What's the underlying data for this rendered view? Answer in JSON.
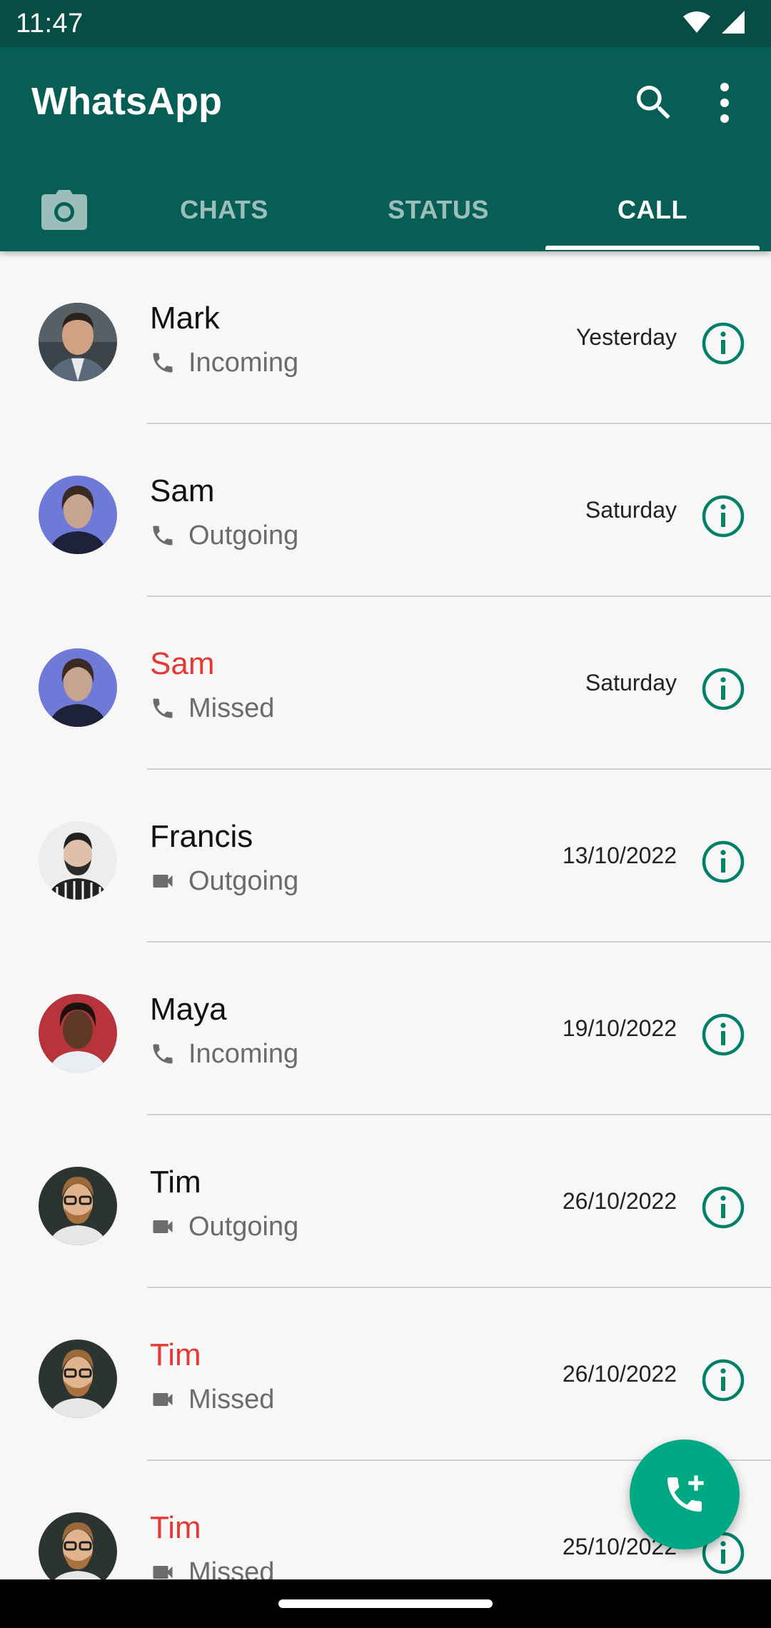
{
  "status_bar": {
    "time": "11:47"
  },
  "app_bar": {
    "title": "WhatsApp"
  },
  "tabs": [
    {
      "label": "CHATS",
      "selected": false
    },
    {
      "label": "STATUS",
      "selected": false
    },
    {
      "label": "CALL",
      "selected": true
    }
  ],
  "calls": [
    {
      "name": "Mark",
      "type": "Incoming",
      "medium": "voice",
      "time": "Yesterday",
      "missed": false
    },
    {
      "name": "Sam",
      "type": "Outgoing",
      "medium": "voice",
      "time": "Saturday",
      "missed": false
    },
    {
      "name": "Sam",
      "type": "Missed",
      "medium": "voice",
      "time": "Saturday",
      "missed": true
    },
    {
      "name": "Francis",
      "type": "Outgoing",
      "medium": "video",
      "time": "13/10/2022",
      "missed": false
    },
    {
      "name": "Maya",
      "type": "Incoming",
      "medium": "voice",
      "time": "19/10/2022",
      "missed": false
    },
    {
      "name": "Tim",
      "type": "Outgoing",
      "medium": "video",
      "time": "26/10/2022",
      "missed": false
    },
    {
      "name": "Tim",
      "type": "Missed",
      "medium": "video",
      "time": "26/10/2022",
      "missed": true
    },
    {
      "name": "Tim",
      "type": "Missed",
      "medium": "video",
      "time": "25/10/2022",
      "missed": true
    }
  ],
  "colors": {
    "app_bar": "#075e54",
    "status_bar": "#064d45",
    "accent": "#00a884",
    "missed": "#e53935",
    "info_icon": "#008069"
  },
  "icons": {
    "search": "search-icon",
    "more": "more-vert-icon",
    "camera": "camera-icon",
    "voice_call": "phone-icon",
    "video_call": "videocam-icon",
    "info": "info-icon",
    "new_call": "add-call-icon"
  }
}
